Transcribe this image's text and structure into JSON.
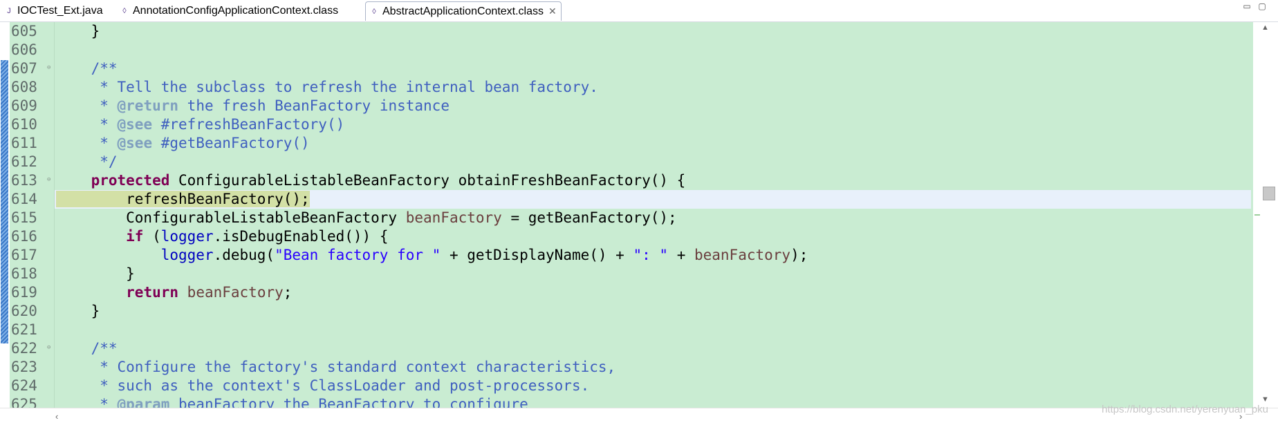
{
  "tabs": [
    {
      "label": "IOCTest_Ext.java",
      "icon": "java-file-icon",
      "active": false
    },
    {
      "label": "AnnotationConfigApplicationContext.class",
      "icon": "class-file-icon",
      "active": false
    },
    {
      "label": "AbstractApplicationContext.class",
      "icon": "class-file-icon",
      "active": true
    }
  ],
  "window_controls": [
    "minimize-icon",
    "maximize-icon"
  ],
  "lines": [
    {
      "number": "605",
      "tokens": [
        {
          "t": "    }",
          "c": "plain"
        }
      ]
    },
    {
      "number": "606",
      "tokens": []
    },
    {
      "number": "607",
      "fold": true,
      "tokens": [
        {
          "t": "    /**",
          "c": "doc"
        }
      ]
    },
    {
      "number": "608",
      "tokens": [
        {
          "t": "     * Tell the subclass to refresh the internal bean factory.",
          "c": "doc"
        }
      ]
    },
    {
      "number": "609",
      "tokens": [
        {
          "t": "     * ",
          "c": "doc"
        },
        {
          "t": "@return",
          "c": "tag"
        },
        {
          "t": " the fresh BeanFactory instance",
          "c": "doc"
        }
      ]
    },
    {
      "number": "610",
      "tokens": [
        {
          "t": "     * ",
          "c": "doc"
        },
        {
          "t": "@see",
          "c": "tag"
        },
        {
          "t": " #refreshBeanFactory()",
          "c": "doc"
        }
      ]
    },
    {
      "number": "611",
      "tokens": [
        {
          "t": "     * ",
          "c": "doc"
        },
        {
          "t": "@see",
          "c": "tag"
        },
        {
          "t": " #getBeanFactory()",
          "c": "doc"
        }
      ]
    },
    {
      "number": "612",
      "tokens": [
        {
          "t": "     */",
          "c": "doc"
        }
      ]
    },
    {
      "number": "613",
      "fold": true,
      "tokens": [
        {
          "t": "    ",
          "c": "plain"
        },
        {
          "t": "protected",
          "c": "kw"
        },
        {
          "t": " ConfigurableListableBeanFactory obtainFreshBeanFactory() {",
          "c": "plain"
        }
      ]
    },
    {
      "number": "614",
      "current": true,
      "tokens": [
        {
          "t": "        refreshBeanFactory();",
          "c": "plain",
          "hl": true
        }
      ]
    },
    {
      "number": "615",
      "tokens": [
        {
          "t": "        ConfigurableListableBeanFactory ",
          "c": "plain"
        },
        {
          "t": "beanFactory",
          "c": "var"
        },
        {
          "t": " = getBeanFactory();",
          "c": "plain"
        }
      ]
    },
    {
      "number": "616",
      "tokens": [
        {
          "t": "        ",
          "c": "plain"
        },
        {
          "t": "if",
          "c": "kw"
        },
        {
          "t": " (",
          "c": "plain"
        },
        {
          "t": "logger",
          "c": "field"
        },
        {
          "t": ".isDebugEnabled()) {",
          "c": "plain"
        }
      ]
    },
    {
      "number": "617",
      "tokens": [
        {
          "t": "            ",
          "c": "plain"
        },
        {
          "t": "logger",
          "c": "field"
        },
        {
          "t": ".debug(",
          "c": "plain"
        },
        {
          "t": "\"Bean factory for \"",
          "c": "str"
        },
        {
          "t": " + getDisplayName() + ",
          "c": "plain"
        },
        {
          "t": "\": \"",
          "c": "str"
        },
        {
          "t": " + ",
          "c": "plain"
        },
        {
          "t": "beanFactory",
          "c": "var"
        },
        {
          "t": ");",
          "c": "plain"
        }
      ]
    },
    {
      "number": "618",
      "tokens": [
        {
          "t": "        }",
          "c": "plain"
        }
      ]
    },
    {
      "number": "619",
      "tokens": [
        {
          "t": "        ",
          "c": "plain"
        },
        {
          "t": "return",
          "c": "kw"
        },
        {
          "t": " ",
          "c": "plain"
        },
        {
          "t": "beanFactory",
          "c": "var"
        },
        {
          "t": ";",
          "c": "plain"
        }
      ]
    },
    {
      "number": "620",
      "tokens": [
        {
          "t": "    }",
          "c": "plain"
        }
      ]
    },
    {
      "number": "621",
      "tokens": []
    },
    {
      "number": "622",
      "fold": true,
      "tokens": [
        {
          "t": "    /**",
          "c": "doc"
        }
      ]
    },
    {
      "number": "623",
      "tokens": [
        {
          "t": "     * Configure the factory's standard context characteristics,",
          "c": "doc"
        }
      ]
    },
    {
      "number": "624",
      "tokens": [
        {
          "t": "     * such as the context's ClassLoader and post-processors.",
          "c": "doc"
        }
      ]
    },
    {
      "number": "625",
      "tokens": [
        {
          "t": "     * ",
          "c": "doc"
        },
        {
          "t": "@param",
          "c": "tag"
        },
        {
          "t": " beanFactory the BeanFactory to configure",
          "c": "doc"
        }
      ]
    }
  ],
  "watermark": "https://blog.csdn.net/yerenyuan_pku"
}
